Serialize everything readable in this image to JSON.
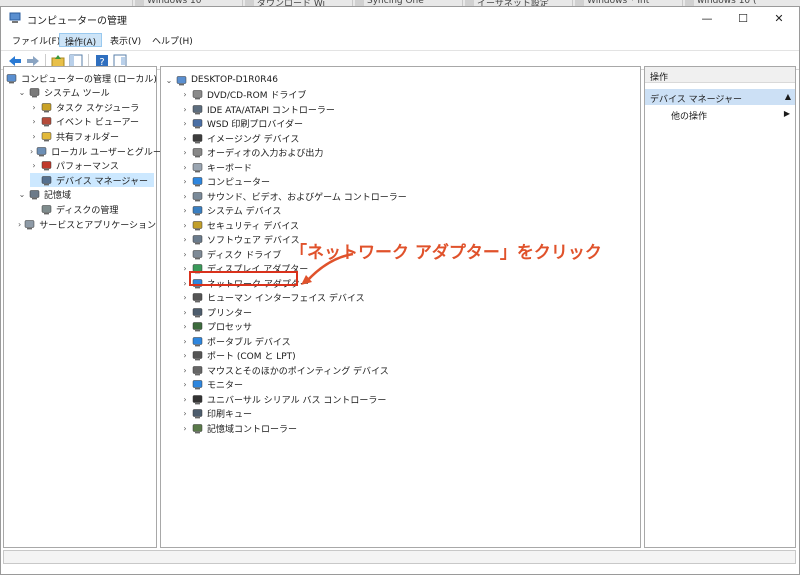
{
  "background_tabs": [
    "Windows 10",
    "ダウンロード Wi",
    "Syncing One",
    "イーサネット設定",
    "Windows * Int",
    "windows 10 ("
  ],
  "window": {
    "title": "コンピューターの管理",
    "controls": {
      "minimize": "—",
      "maximize": "☐",
      "close": "✕"
    }
  },
  "menu": [
    "ファイル(F)",
    "操作(A)",
    "表示(V)",
    "ヘルプ(H)"
  ],
  "toolbar_icons": [
    "back-icon",
    "forward-icon",
    "up-folder-icon",
    "show-hide-tree-icon",
    "help-icon",
    "properties-icon"
  ],
  "left_tree": [
    {
      "label": "コンピューターの管理 (ローカル)",
      "icon": "computer-management-icon",
      "level": 0,
      "chevron": ""
    },
    {
      "label": "システム ツール",
      "icon": "tools-icon",
      "level": 1,
      "chevron": "v"
    },
    {
      "label": "タスク スケジューラ",
      "icon": "clock-icon",
      "level": 2,
      "chevron": ">"
    },
    {
      "label": "イベント ビューアー",
      "icon": "event-viewer-icon",
      "level": 2,
      "chevron": ">"
    },
    {
      "label": "共有フォルダー",
      "icon": "shared-folder-icon",
      "level": 2,
      "chevron": ">"
    },
    {
      "label": "ローカル ユーザーとグループ",
      "icon": "users-icon",
      "level": 2,
      "chevron": ">"
    },
    {
      "label": "パフォーマンス",
      "icon": "performance-icon",
      "level": 2,
      "chevron": ">"
    },
    {
      "label": "デバイス マネージャー",
      "icon": "device-manager-icon",
      "level": 2,
      "chevron": "",
      "selected": true
    },
    {
      "label": "記憶域",
      "icon": "storage-icon",
      "level": 1,
      "chevron": "v"
    },
    {
      "label": "ディスクの管理",
      "icon": "disk-management-icon",
      "level": 2,
      "chevron": ""
    },
    {
      "label": "サービスとアプリケーション",
      "icon": "services-icon",
      "level": 1,
      "chevron": ">"
    }
  ],
  "device_tree": {
    "root": "DESKTOP-D1R0R46",
    "items": [
      {
        "label": "DVD/CD-ROM ドライブ",
        "icon": "dvd-drive-icon"
      },
      {
        "label": "IDE ATA/ATAPI コントローラー",
        "icon": "ide-controller-icon"
      },
      {
        "label": "WSD 印刷プロバイダー",
        "icon": "printer-provider-icon"
      },
      {
        "label": "イメージング デバイス",
        "icon": "camera-icon"
      },
      {
        "label": "オーディオの入力および出力",
        "icon": "speaker-icon"
      },
      {
        "label": "キーボード",
        "icon": "keyboard-icon"
      },
      {
        "label": "コンピューター",
        "icon": "monitor-icon"
      },
      {
        "label": "サウンド、ビデオ、およびゲーム コントローラー",
        "icon": "sound-icon"
      },
      {
        "label": "システム デバイス",
        "icon": "system-device-icon"
      },
      {
        "label": "セキュリティ デバイス",
        "icon": "security-device-icon"
      },
      {
        "label": "ソフトウェア デバイス",
        "icon": "software-device-icon"
      },
      {
        "label": "ディスク ドライブ",
        "icon": "disk-drive-icon"
      },
      {
        "label": "ディスプレイ アダプター",
        "icon": "display-adapter-icon"
      },
      {
        "label": "ネットワーク アダプター",
        "icon": "network-adapter-icon",
        "highlighted": true
      },
      {
        "label": "ヒューマン インターフェイス デバイス",
        "icon": "hid-icon"
      },
      {
        "label": "プリンター",
        "icon": "printer-icon"
      },
      {
        "label": "プロセッサ",
        "icon": "processor-icon"
      },
      {
        "label": "ポータブル デバイス",
        "icon": "portable-device-icon"
      },
      {
        "label": "ポート (COM と LPT)",
        "icon": "port-icon"
      },
      {
        "label": "マウスとそのほかのポインティング デバイス",
        "icon": "mouse-icon"
      },
      {
        "label": "モニター",
        "icon": "monitor-icon"
      },
      {
        "label": "ユニバーサル シリアル バス コントローラー",
        "icon": "usb-icon"
      },
      {
        "label": "印刷キュー",
        "icon": "print-queue-icon"
      },
      {
        "label": "記憶域コントローラー",
        "icon": "storage-controller-icon"
      }
    ]
  },
  "actions": {
    "header": "操作",
    "section": "デバイス マネージャー",
    "items": [
      "他の操作"
    ]
  },
  "annotation": "「ネットワーク アダプター」をクリック",
  "colors": {
    "selection": "#cce8ff",
    "annotation": "#e0522b",
    "highlight_border": "#d9321c"
  }
}
